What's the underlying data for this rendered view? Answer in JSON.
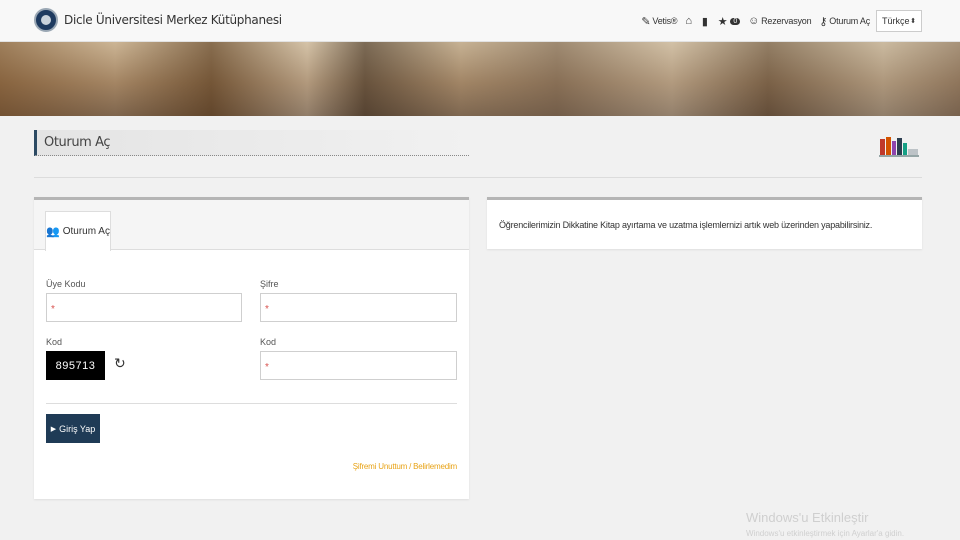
{
  "navbar": {
    "brand": "Dicle Üniversitesi Merkez Kütüphanesi",
    "items": [
      {
        "icon": "edit-icon",
        "label": "Vetis®"
      },
      {
        "icon": "home-icon",
        "label": ""
      },
      {
        "icon": "book-icon",
        "label": ""
      },
      {
        "icon": "star-icon",
        "label": "",
        "badge": "0"
      },
      {
        "icon": "user-icon",
        "label": "Rezervasyon"
      },
      {
        "icon": "key-icon",
        "label": "Oturum Aç"
      }
    ],
    "language": "Türkçe"
  },
  "page": {
    "title": "Oturum Aç"
  },
  "login": {
    "tab_label": "Oturum Aç",
    "member_code_label": "Üye Kodu",
    "password_label": "Şifre",
    "code_label": "Kod",
    "code_input_label": "Kod",
    "required_mark": "*",
    "captcha": "895713",
    "submit_label": "Giriş Yap",
    "forgot_link": "Şifremi Unuttum / Belirlemedim"
  },
  "notice": {
    "text": "Öğrencilerimizin Dikkatine Kitap ayırtama ve uzatma işlemlernizi artık web üzerinden yapabilirsiniz."
  },
  "watermark": {
    "title": "Windows'u Etkinleştir",
    "subtitle": "Windows'u etkinleştirmek için Ayarlar'a gidin."
  },
  "colors": {
    "primary": "#1f3b56",
    "link": "#e8a317",
    "required": "#d9534f"
  }
}
